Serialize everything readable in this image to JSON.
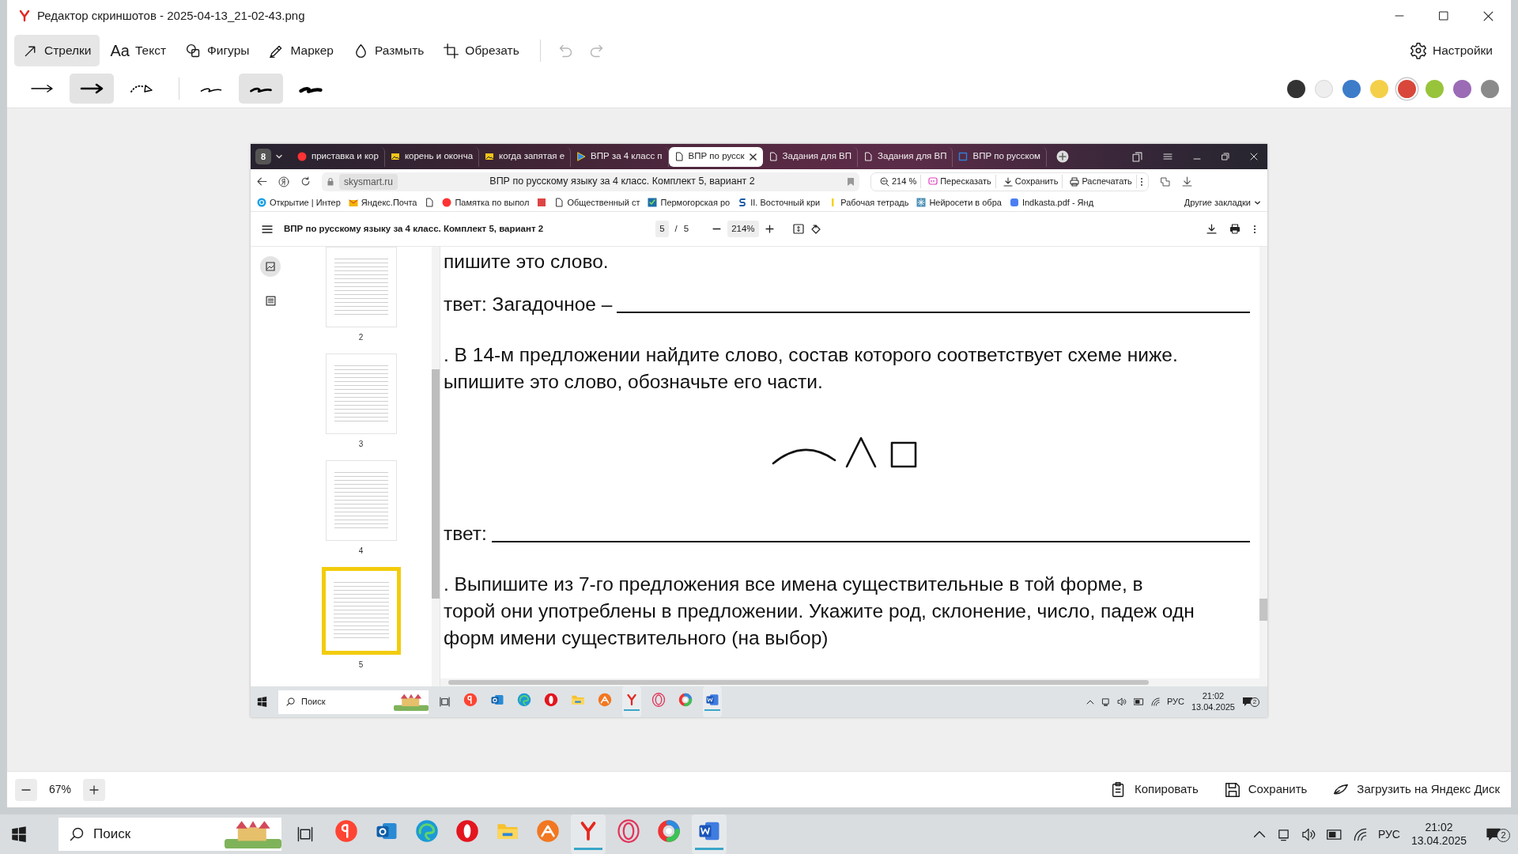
{
  "window": {
    "title": "Редактор скриншотов - 2025-04-13_21-02-43.png"
  },
  "tools": [
    {
      "kind": "arrow",
      "label": "Стрелки",
      "selected": true
    },
    {
      "kind": "text",
      "glyph": "Aa",
      "label": "Текст",
      "selected": false
    },
    {
      "kind": "shapes",
      "label": "Фигуры",
      "selected": false
    },
    {
      "kind": "marker",
      "label": "Маркер",
      "selected": false
    },
    {
      "kind": "blur",
      "label": "Размыть",
      "selected": false
    },
    {
      "kind": "crop",
      "label": "Обрезать",
      "selected": false
    }
  ],
  "history": [
    {
      "kind": "undo",
      "disabled": true
    },
    {
      "kind": "redo",
      "disabled": true
    }
  ],
  "settings": {
    "label": "Настройки"
  },
  "arrow_styles": [
    {
      "kind": "thin",
      "selected": false
    },
    {
      "kind": "thick",
      "selected": true
    },
    {
      "kind": "dotted",
      "selected": false
    }
  ],
  "line_styles": [
    {
      "kind": "thin",
      "selected": false
    },
    {
      "kind": "medium",
      "selected": true
    },
    {
      "kind": "thick",
      "selected": false
    }
  ],
  "colors": [
    {
      "color": "#333333",
      "selected": false
    },
    {
      "color": "#eeeeee",
      "selected": false
    },
    {
      "color": "#3d7cc9",
      "selected": false
    },
    {
      "color": "#f4cf48",
      "selected": false
    },
    {
      "color": "#d9473a",
      "selected": true
    },
    {
      "color": "#98c43b",
      "selected": false
    },
    {
      "color": "#9b6bb5",
      "selected": false
    },
    {
      "color": "#8a8a8a",
      "selected": false
    }
  ],
  "screenshot": {
    "tab_count": "8",
    "tabs": [
      {
        "kind": "yandex",
        "label": "приставка и кор",
        "selected": false
      },
      {
        "kind": "image",
        "label": "корень и оконча",
        "selected": false
      },
      {
        "kind": "image",
        "label": "когда запятая е",
        "selected": false
      },
      {
        "kind": "play",
        "label": "ВПР за 4 класс п",
        "selected": false
      },
      {
        "kind": "doc",
        "label": "ВПР по русск",
        "selected": true
      },
      {
        "kind": "doc",
        "label": "Задания для ВП",
        "selected": false
      },
      {
        "kind": "doc",
        "label": "Задания для ВП",
        "selected": false
      },
      {
        "kind": "vpr",
        "label": "ВПР по русском",
        "selected": false
      }
    ],
    "address": {
      "domain": "skysmart.ru",
      "title": "ВПР по русскому языку за 4 класс. Комплект 5, вариант 2"
    },
    "page_actions": [
      {
        "kind": "zoom",
        "label": "214 %"
      },
      {
        "kind": "retell",
        "label": "Пересказать"
      },
      {
        "kind": "save",
        "label": "Сохранить"
      },
      {
        "kind": "print",
        "label": "Распечатать"
      }
    ],
    "bookmarks": [
      {
        "kind": "blue",
        "label": "Открытие | Интер"
      },
      {
        "kind": "mail",
        "label": "Яндекс.Почта"
      },
      {
        "kind": "doc"
      },
      {
        "kind": "yandex",
        "label": "Памятка по выпол"
      },
      {
        "kind": "pdf"
      },
      {
        "kind": "doc",
        "label": "Общественный ст"
      },
      {
        "kind": "check",
        "label": "Пермогорская ро"
      },
      {
        "kind": "s",
        "label": "II. Восточный кри"
      },
      {
        "kind": "bar",
        "label": "Рабочая тетрадь"
      },
      {
        "kind": "star",
        "label": "Нейросети в обра"
      },
      {
        "kind": "disk",
        "label": "Indkasta.pdf - Янд"
      }
    ],
    "other_bookmarks": "Другие закладки",
    "pdf": {
      "title": "ВПР по русскому языку за 4 класс. Комплект 5, вариант 2",
      "page": "5",
      "separator": "/",
      "total": "5",
      "zoom": "214%"
    },
    "thumbnails": [
      {
        "label": "2",
        "selected": false
      },
      {
        "label": "3",
        "selected": false
      },
      {
        "label": "4",
        "selected": false
      },
      {
        "label": "5",
        "selected": true
      }
    ],
    "document": [
      {
        "kind": "text",
        "text": "пишите это слово."
      },
      {
        "kind": "answer",
        "text": "твет: Загадочное –"
      },
      {
        "kind": "text",
        "text": ". В 14-м предложении найдите слово, состав которого соответствует схеме ниже."
      },
      {
        "kind": "text",
        "text": "ыпишите это слово, обозначьте его части."
      },
      {
        "kind": "scheme"
      },
      {
        "kind": "answer",
        "text": "твет:"
      },
      {
        "kind": "text",
        "text": ". Выпишите из 7-го предложения все имена существительные в той форме, в"
      },
      {
        "kind": "text",
        "text": "торой они употреблены в предложении. Укажите род, склонение, число, падеж одн"
      },
      {
        "kind": "text",
        "text": "форм имени существительного (на выбор)"
      }
    ],
    "taskbar": {
      "search": "Поиск",
      "lang": "РУС",
      "time": "21:02",
      "date": "13.04.2025",
      "notifications": "2"
    }
  },
  "zoom": {
    "label": "67%"
  },
  "actions": [
    {
      "kind": "copy",
      "label": "Копировать"
    },
    {
      "kind": "save",
      "label": "Сохранить"
    },
    {
      "kind": "upload",
      "label": "Загрузить на Яндекс Диск"
    }
  ],
  "taskbar": {
    "search": "Поиск",
    "apps": [
      {
        "kind": "yandex",
        "active": false
      },
      {
        "kind": "mail",
        "active": false
      },
      {
        "kind": "edge",
        "active": false
      },
      {
        "kind": "opera",
        "active": false
      },
      {
        "kind": "folder",
        "active": false
      },
      {
        "kind": "orange",
        "active": false
      },
      {
        "kind": "ybrowser",
        "active": true
      },
      {
        "kind": "ring",
        "active": false
      },
      {
        "kind": "wheel",
        "active": false
      },
      {
        "kind": "word",
        "active": true
      }
    ],
    "lang": "РУС",
    "time": "21:02",
    "date": "13.04.2025",
    "notifications": "2"
  }
}
